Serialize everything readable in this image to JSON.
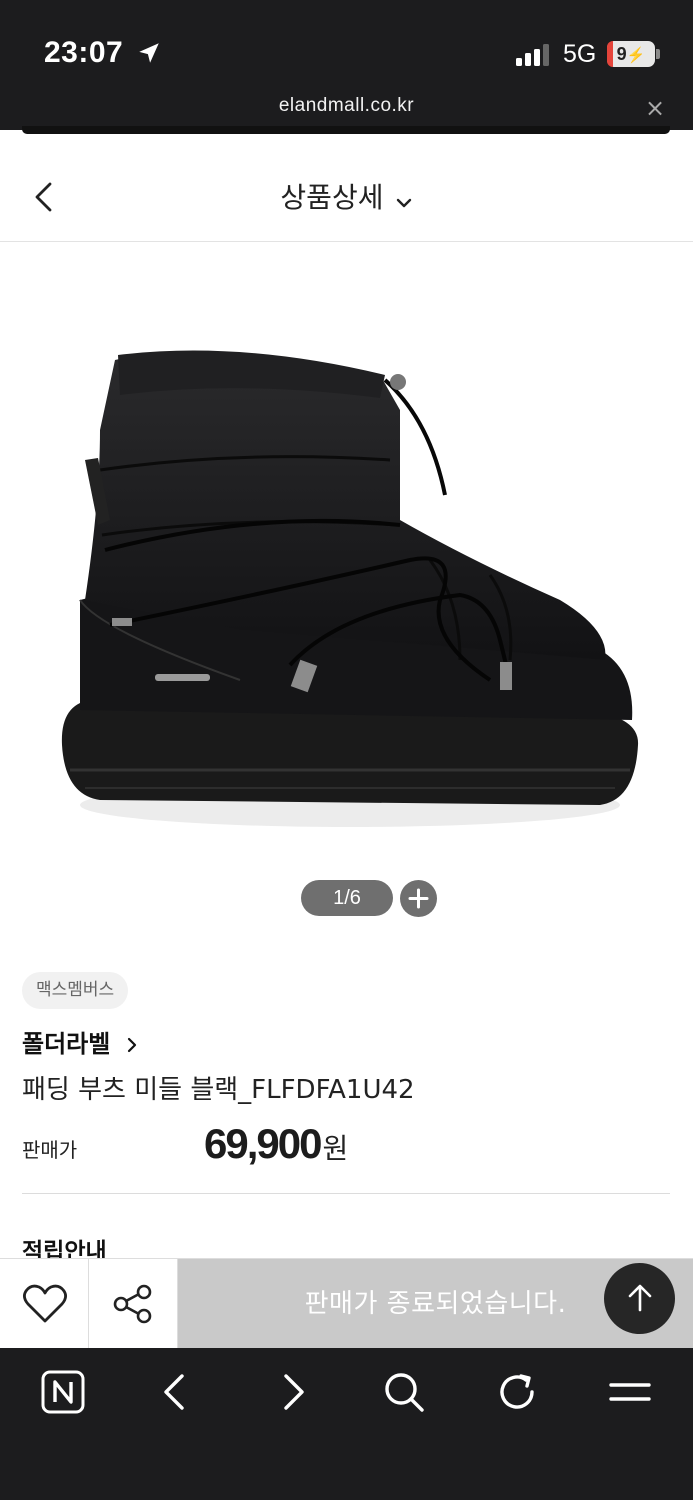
{
  "status_bar": {
    "time": "23:07",
    "network": "5G",
    "battery": "9",
    "battery_level": 0.09,
    "icons": [
      "location-arrow-icon",
      "signal-icon",
      "battery-charging-icon"
    ]
  },
  "browser": {
    "url": "elandmall.co.kr",
    "close_symbol": "×",
    "toolbar_icons": [
      "naver-home-icon",
      "back-arrow-icon",
      "forward-arrow-icon",
      "search-icon",
      "refresh-icon",
      "menu-icon"
    ]
  },
  "header": {
    "title": "상품상세",
    "icons": [
      "back-chevron-icon",
      "chevron-down-icon"
    ]
  },
  "gallery": {
    "pager": "1/6",
    "icons": [
      "zoom-plus-icon"
    ]
  },
  "product": {
    "brand_tag": "맥스멤버스",
    "store": "폴더라벨",
    "name": "패딩 부츠 미들 블랙_FLFDFA1U42",
    "price_label": "판매가",
    "price": "69,900",
    "price_unit": "원"
  },
  "sections": {
    "points_title": "적립안내"
  },
  "action_bar": {
    "soldout_text": "판매가 종료되었습니다.",
    "icons": [
      "heart-icon",
      "share-icon",
      "arrow-up-icon"
    ]
  },
  "colors": {
    "status_bar_bg": "#1c1c1e",
    "soldout_bg": "#c9c9c9",
    "pager_bg": "#6f6f6f",
    "battery_red": "#e5443b"
  }
}
